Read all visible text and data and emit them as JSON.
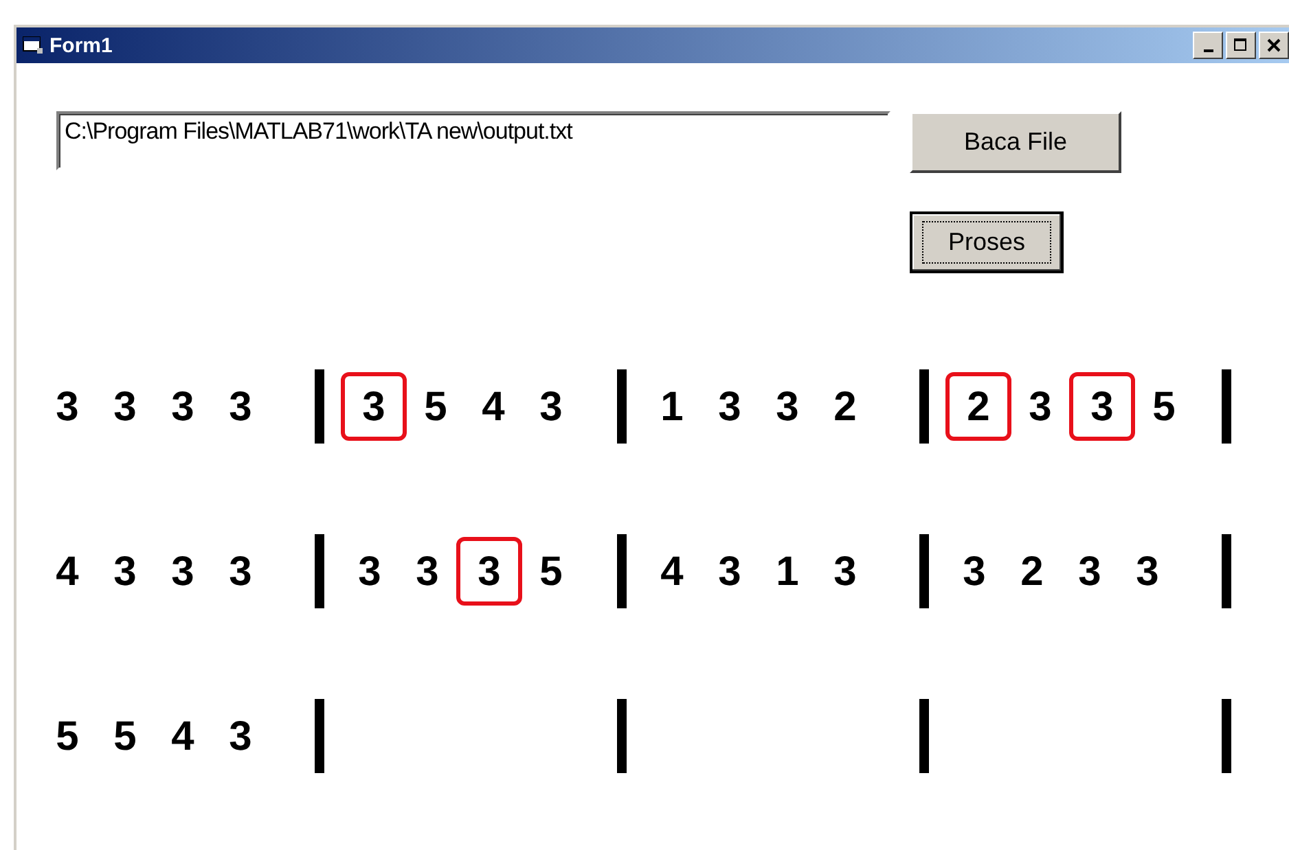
{
  "window": {
    "title": "Form1"
  },
  "file_path": {
    "value": "C:\\Program Files\\MATLAB71\\work\\TA new\\output.txt"
  },
  "buttons": [
    {
      "label": "Baca File",
      "focused": false
    },
    {
      "label": "Proses",
      "focused": true
    }
  ],
  "rows": [
    {
      "measures": [
        {
          "notes": [
            {
              "text": "3",
              "marked": false
            },
            {
              "text": "3",
              "marked": false
            },
            {
              "text": "3",
              "marked": false
            },
            {
              "text": "3",
              "marked": false
            }
          ]
        },
        {
          "notes": [
            {
              "text": "3",
              "marked": true
            },
            {
              "text": "5",
              "marked": false
            },
            {
              "text": "4",
              "marked": false
            },
            {
              "text": "3",
              "marked": false
            }
          ]
        },
        {
          "notes": [
            {
              "text": "1",
              "marked": false
            },
            {
              "text": "3",
              "marked": false
            },
            {
              "text": "3",
              "marked": false
            },
            {
              "text": "2",
              "marked": false
            }
          ]
        },
        {
          "notes": [
            {
              "text": "2",
              "marked": true
            },
            {
              "text": "3",
              "marked": false
            },
            {
              "text": "3",
              "marked": true
            },
            {
              "text": "5",
              "marked": false
            }
          ]
        }
      ]
    },
    {
      "measures": [
        {
          "notes": [
            {
              "text": "4",
              "marked": false
            },
            {
              "text": "3",
              "marked": false
            },
            {
              "text": "3",
              "marked": false
            },
            {
              "text": "3",
              "marked": false
            }
          ]
        },
        {
          "notes": [
            {
              "text": "3",
              "marked": false
            },
            {
              "text": "3",
              "marked": false
            },
            {
              "text": "3",
              "marked": true
            },
            {
              "text": "5",
              "marked": false
            }
          ]
        },
        {
          "notes": [
            {
              "text": "4",
              "marked": false
            },
            {
              "text": "3",
              "marked": false
            },
            {
              "text": "1",
              "marked": false
            },
            {
              "text": "3",
              "marked": false
            }
          ]
        },
        {
          "notes": [
            {
              "text": "3",
              "marked": false
            },
            {
              "text": "2",
              "marked": false
            },
            {
              "text": "3",
              "marked": false
            },
            {
              "text": "3",
              "marked": false
            }
          ]
        }
      ]
    },
    {
      "measures": [
        {
          "notes": [
            {
              "text": "5",
              "marked": false
            },
            {
              "text": "5",
              "marked": false
            },
            {
              "text": "4",
              "marked": false
            },
            {
              "text": "3",
              "marked": false
            }
          ]
        },
        {
          "kind": "empty"
        },
        {
          "kind": "empty"
        },
        {
          "kind": "empty"
        }
      ]
    }
  ]
}
